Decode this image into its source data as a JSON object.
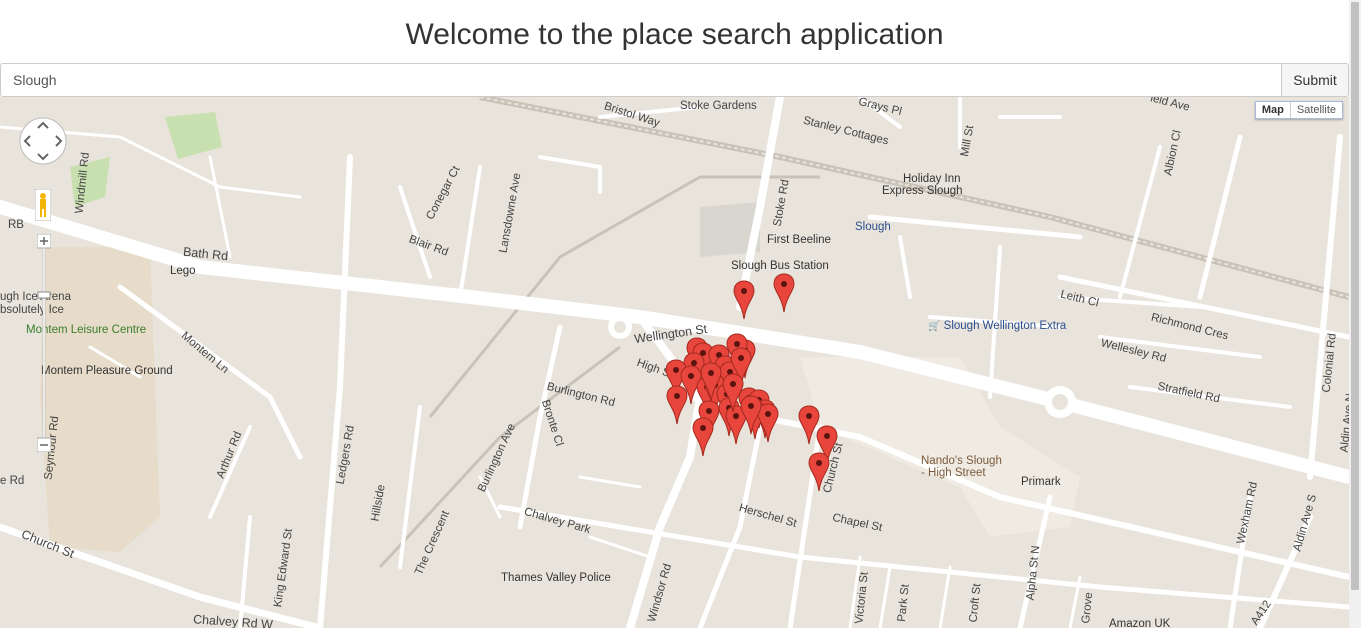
{
  "header": {
    "title": "Welcome to the place search application"
  },
  "search": {
    "value": "Slough",
    "submit_label": "Submit"
  },
  "map": {
    "type_controls": {
      "map_label": "Map",
      "satellite_label": "Satellite"
    },
    "street_labels": [
      "Bristol Way",
      "Stoke Gardens",
      "Grays Pl",
      "Stanley Cottages",
      "Mill St",
      "Albion Cl",
      "Conegar Ct",
      "Lansdowne Ave",
      "Stoke Rd",
      "Bath Rd",
      "Blair Rd",
      "Windmill Rd",
      "Wellington St",
      "High St",
      "Burlington Rd",
      "Burlington Ave",
      "Bronte Cl",
      "Montem Ln",
      "Arthur Rd",
      "Ledgers Rd",
      "Hillside",
      "The Crescent",
      "King Edward St",
      "Chalvey Park",
      "Church St",
      "Chalvey Rd W",
      "Windsor Rd",
      "Herschel St",
      "Chapel St",
      "Church St",
      "Leith Cl",
      "Richmond Cres",
      "Wellesley Rd",
      "Stratfield Rd",
      "Colonial Rd",
      "Aldin Ave N",
      "Aldin Ave S",
      "Wexham Rd",
      "Alpha St N",
      "Victoria St",
      "Park St",
      "Croft St",
      "Grove",
      "A412",
      "Seymour Rd",
      "RB",
      "e Rd",
      "ugh Ice Arena",
      "bsolutely Ice",
      "ield Ave"
    ],
    "pois": {
      "holiday_inn": "Holiday Inn Express Slough",
      "holiday_inn_line1": "Holiday Inn",
      "holiday_inn_line2": "Express Slough",
      "slough_station": "Slough",
      "first_beeline": "First Beeline",
      "bus_station": "Slough Bus Station",
      "wellington_extra": "Slough Wellington Extra",
      "lego": "Lego",
      "montem_leisure": "Montem Leisure Centre",
      "montem_ground": "Montem Pleasure Ground",
      "nandos_line1": "Nando's Slough",
      "nandos_line2": "- High Street",
      "primark": "Primark",
      "thames_valley_police": "Thames Valley Police",
      "amazon_uk": "Amazon UK"
    },
    "marker_count": 32,
    "colors": {
      "marker": "#e8453c",
      "road": "#ffffff",
      "land": "#e8e4dc",
      "park": "#c8dfb0"
    }
  }
}
